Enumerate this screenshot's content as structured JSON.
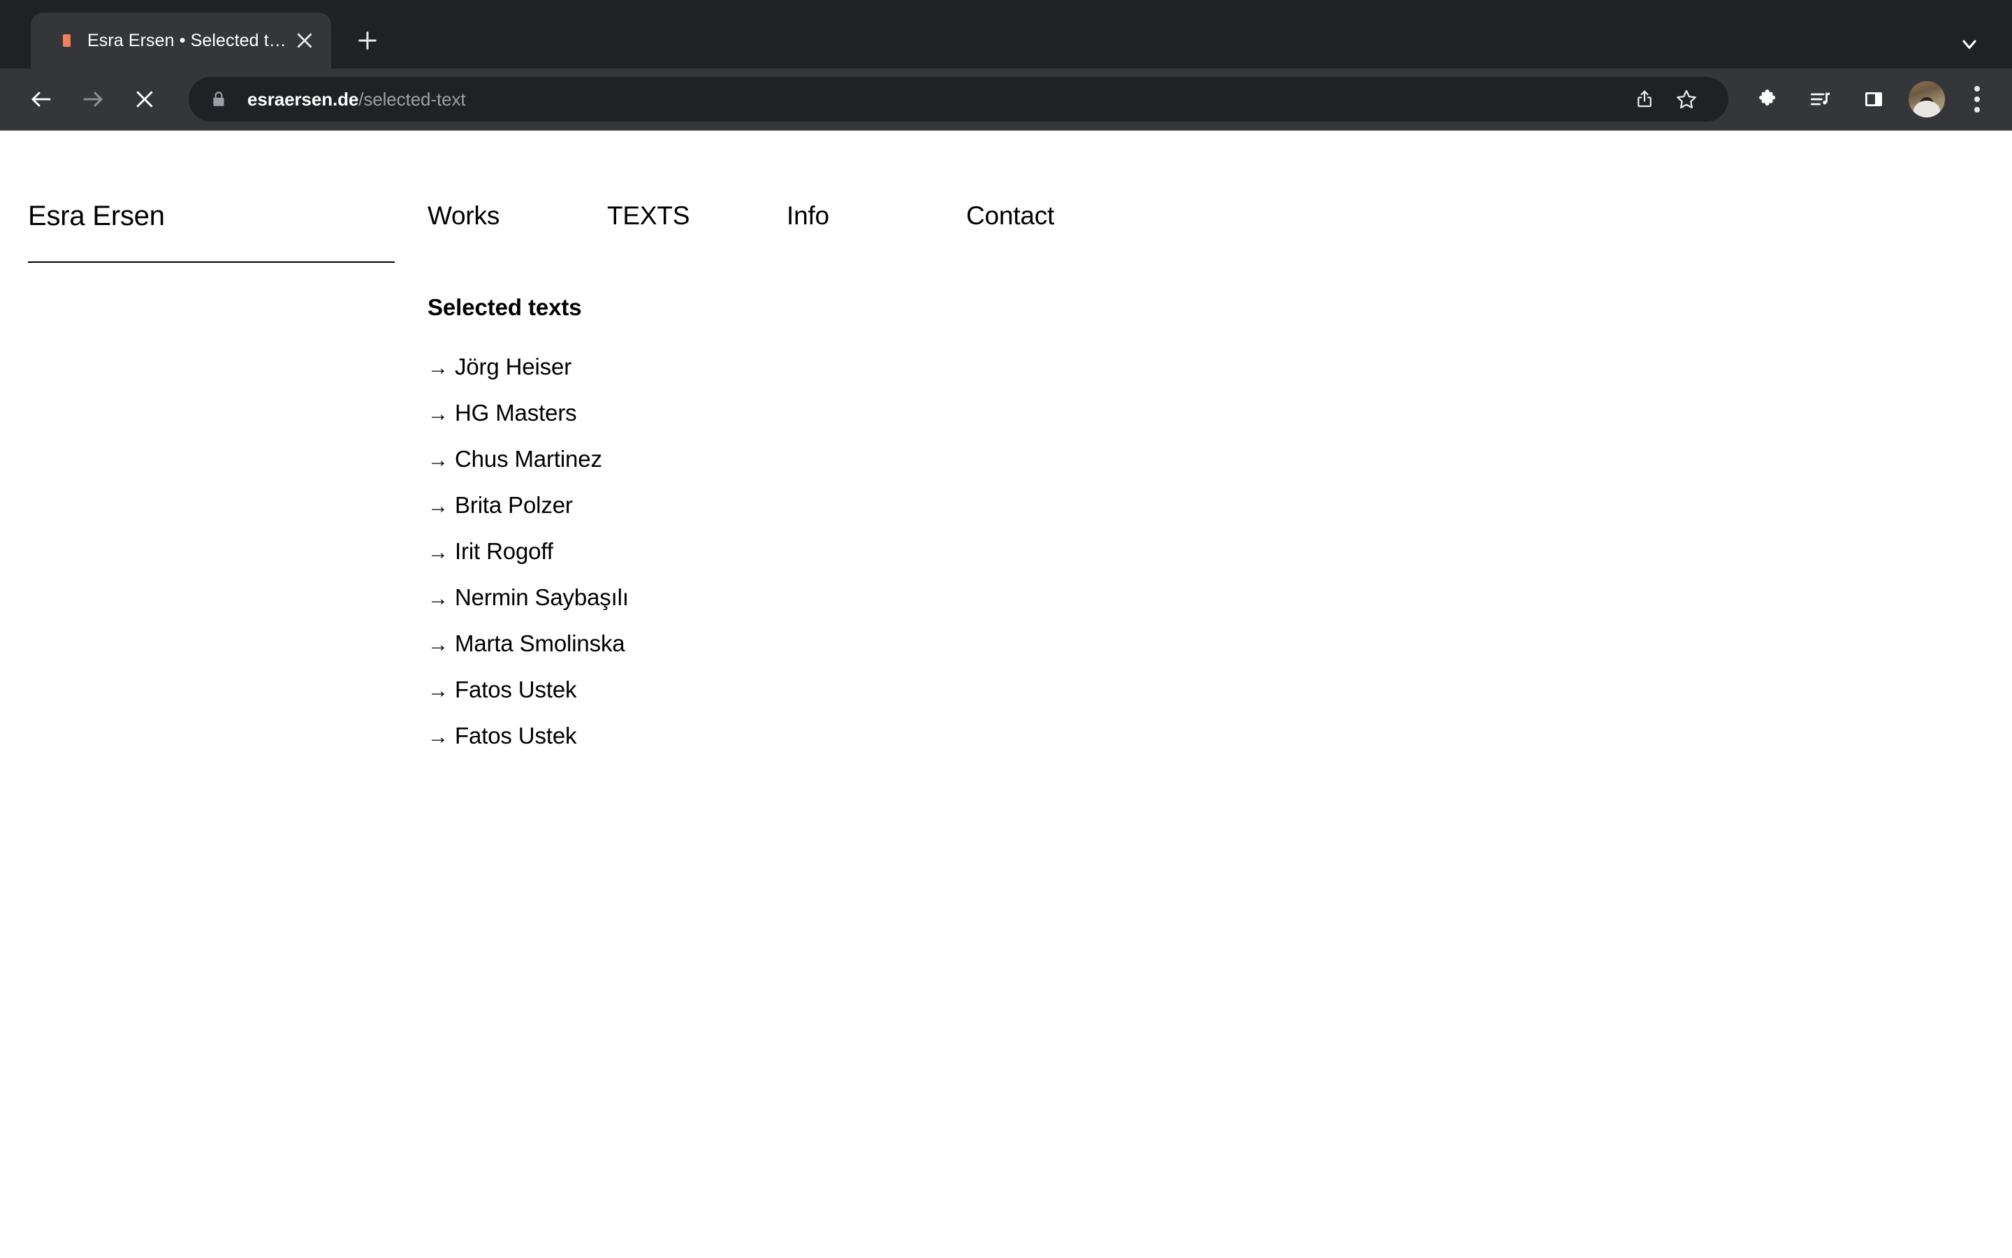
{
  "browser": {
    "tab": {
      "title": "Esra Ersen • Selected texts",
      "favicon_color": "#f08060",
      "close_label": "✕"
    },
    "new_tab_label": "+",
    "tab_search_label": "⌄",
    "toolbar": {
      "back_label": "←",
      "forward_label": "→",
      "stop_label": "✕",
      "url_host": "esraersen.de",
      "url_path": "/selected-text",
      "secure": true
    },
    "icons": {
      "lock": "lock-icon",
      "share": "share-icon",
      "bookmark": "star-icon",
      "extensions": "puzzle-icon",
      "media": "media-list-icon",
      "side_panel": "side-panel-icon",
      "profile": "avatar-icon",
      "menu": "three-dot-menu-icon"
    },
    "theme": {
      "tabstrip_bg": "#202124",
      "toolbar_bg": "#35363a",
      "urlbar_bg": "#202124",
      "active_tab_bg": "#35363a",
      "text": "#ffffff",
      "muted_text": "#9aa0a6"
    }
  },
  "site": {
    "brand": "Esra Ersen",
    "nav": [
      {
        "label": "Works"
      },
      {
        "label": "TEXTS"
      },
      {
        "label": "Info"
      },
      {
        "label": "Contact"
      }
    ],
    "section_title": "Selected texts",
    "arrow_glyph": "→",
    "texts": [
      {
        "label": "Jörg Heiser"
      },
      {
        "label": "HG Masters"
      },
      {
        "label": "Chus Martinez"
      },
      {
        "label": "Brita Polzer"
      },
      {
        "label": "Irit Rogoff"
      },
      {
        "label": "Nermin Saybaşılı"
      },
      {
        "label": "Marta Smolinska"
      },
      {
        "label": "Fatos Ustek"
      },
      {
        "label": "Fatos Ustek"
      }
    ]
  }
}
